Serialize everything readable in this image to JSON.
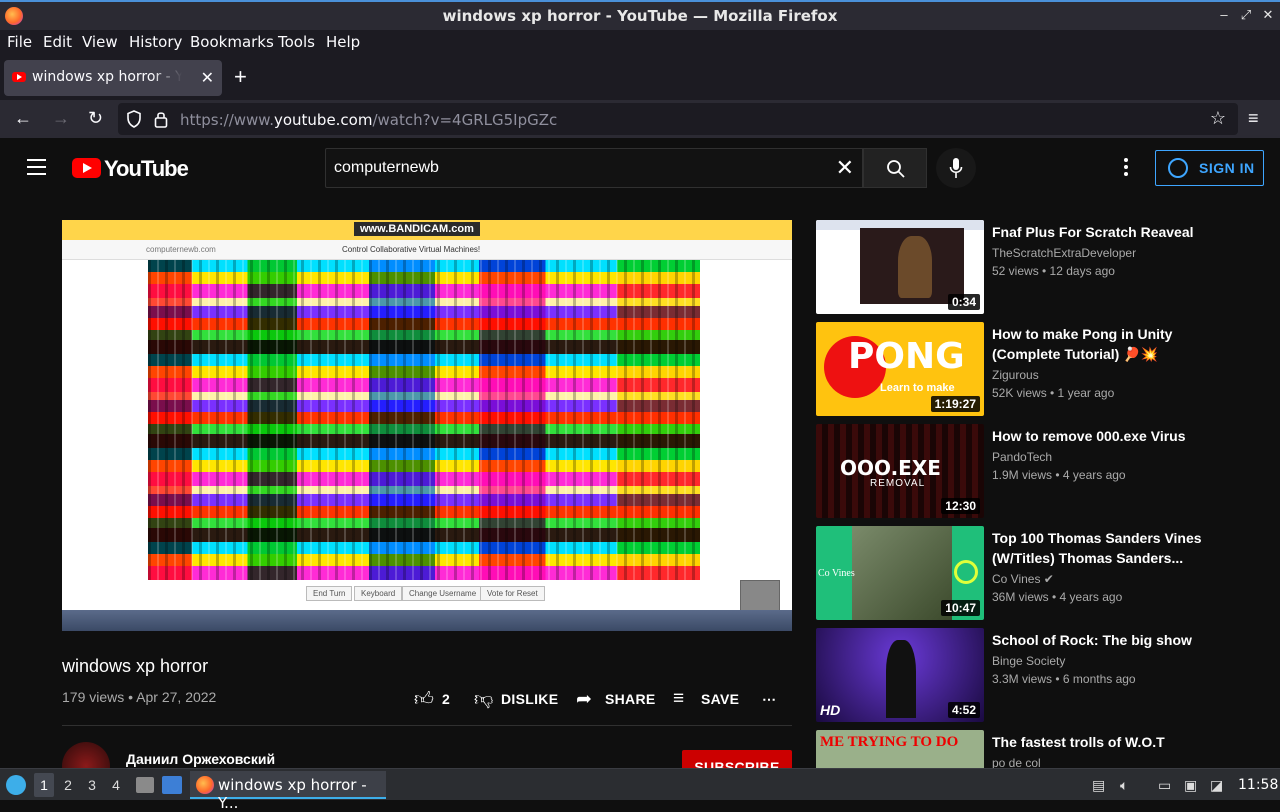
{
  "window": {
    "title": "windows xp horror - YouTube — Mozilla Firefox"
  },
  "menu": [
    "File",
    "Edit",
    "View",
    "History",
    "Bookmarks",
    "Tools",
    "Help"
  ],
  "tab": {
    "label": "windows xp horror - YouTube"
  },
  "navbar": {
    "url_prefix": "https://www.",
    "url_domain": "youtube.com",
    "url_path": "/watch?v=4GRLG5IpGZc"
  },
  "youtube": {
    "logo_text": "YouTube",
    "search_value": "computernewb",
    "sign_in": "SIGN IN"
  },
  "player": {
    "bandicam": "www.BANDICAM.com",
    "inner_title": "Control Collaborative Virtual Machines!",
    "inner_url": "computernewb.com",
    "buttons": [
      "End Turn",
      "Keyboard",
      "Change Username",
      "Vote for Reset"
    ]
  },
  "video": {
    "title": "windows xp horror",
    "meta": "179 views • Apr 27, 2022",
    "likes": "2",
    "dislike": "DISLIKE",
    "share": "SHARE",
    "save": "SAVE",
    "channel": "Даниил Оржеховский",
    "subscribe": "SUBSCRIBE"
  },
  "recommendations": [
    {
      "title": "Fnaf Plus For Scratch Reaveal",
      "channel": "TheScratchExtraDeveloper",
      "meta": "52 views • 12 days ago",
      "duration": "0:34"
    },
    {
      "title": "How to make Pong in Unity (Complete Tutorial) 🏓💥",
      "channel": "Zigurous",
      "meta": "52K views • 1 year ago",
      "duration": "1:19:27",
      "thumb_text": "PONG",
      "thumb_sub": "Learn to make"
    },
    {
      "title": "How to remove 000.exe Virus",
      "channel": "PandoTech",
      "meta": "1.9M views • 4 years ago",
      "duration": "12:30",
      "thumb_text": "OOO.EXE",
      "thumb_sub": "REMOVAL"
    },
    {
      "title": "Top 100 Thomas Sanders Vines (W/Titles) Thomas Sanders...",
      "channel": "Co Vines ✔",
      "meta": "36M views • 4 years ago",
      "duration": "10:47",
      "thumb_text": "Co Vines"
    },
    {
      "title": "School of Rock: The big show",
      "channel": "Binge Society",
      "meta": "3.3M views • 6 months ago",
      "duration": "4:52",
      "thumb_text": "HD"
    },
    {
      "title": "The fastest trolls of W.O.T",
      "channel": "po de col",
      "meta": "",
      "duration": "",
      "thumb_text": "ME TRYING TO DO"
    }
  ],
  "taskbar": {
    "workspaces": [
      "1",
      "2",
      "3",
      "4"
    ],
    "active_window": "windows xp horror - Y...",
    "clock": "11:58"
  }
}
